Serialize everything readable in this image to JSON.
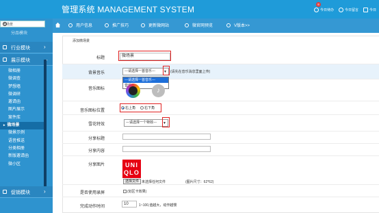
{
  "header": {
    "title": "管理系统 MANAGEMENT SYSTEM",
    "tools": [
      {
        "label": "今日待办",
        "badge": "8"
      },
      {
        "label": "今日留言",
        "badge": ""
      },
      {
        "label": "今日",
        "badge": ""
      }
    ]
  },
  "sidebar": {
    "search_placeholder": "微场景",
    "cut_item": "分品模块",
    "modules": [
      {
        "label": "行业模块"
      },
      {
        "label": "展示模块"
      }
    ],
    "sub_items": [
      "微相册",
      "微调查",
      "梦想墙",
      "微调研",
      "邀请函",
      "图片展示",
      "案件库",
      "微场景",
      "微景示例",
      "语音推送",
      "分类相册",
      "新版邀请函",
      "微小区"
    ],
    "active_index": 7,
    "bottom_module": {
      "label": "促销模块"
    }
  },
  "nav": {
    "items": [
      {
        "label": "用户信息"
      },
      {
        "label": "推广技巧"
      },
      {
        "label": "更新微网站"
      },
      {
        "label": "微官网预览"
      },
      {
        "label": "V版本>>"
      }
    ]
  },
  "form": {
    "heading": "添加微场景",
    "title_label": "标题",
    "title_value": "微场景",
    "bg_music_label": "背景音乐",
    "bg_music_value": "---请选择一首音乐---",
    "bg_music_hint": "(请先在音乐消息里面上传)",
    "bg_music_options": [
      "---请选择一首音乐---",
      "音乐"
    ],
    "music_icon_label": "音乐图标",
    "icon_position_label": "音乐图标位置",
    "icon_position_options": [
      "右上角",
      "右下角"
    ],
    "snow_label": "雪花特效",
    "snow_value": "---请选择一个特效---",
    "share_title_label": "分享标题",
    "share_title_value": "",
    "share_content_label": "分享内容",
    "share_content_value": "",
    "share_image_label": "分享图片",
    "logo_text": "UNI QLO",
    "choose_file_label": "选择文件",
    "no_file_text": "未选择任何文件",
    "image_size_hint": "(图片尺寸：62*62)",
    "loop_label": "是否使用录屏",
    "loop_checkbox_label": "(划区卡效果)",
    "finish_time_label": "完成动作时间",
    "finish_time_value": "10",
    "finish_time_hint": "1~100,值越大，动作越慢"
  }
}
